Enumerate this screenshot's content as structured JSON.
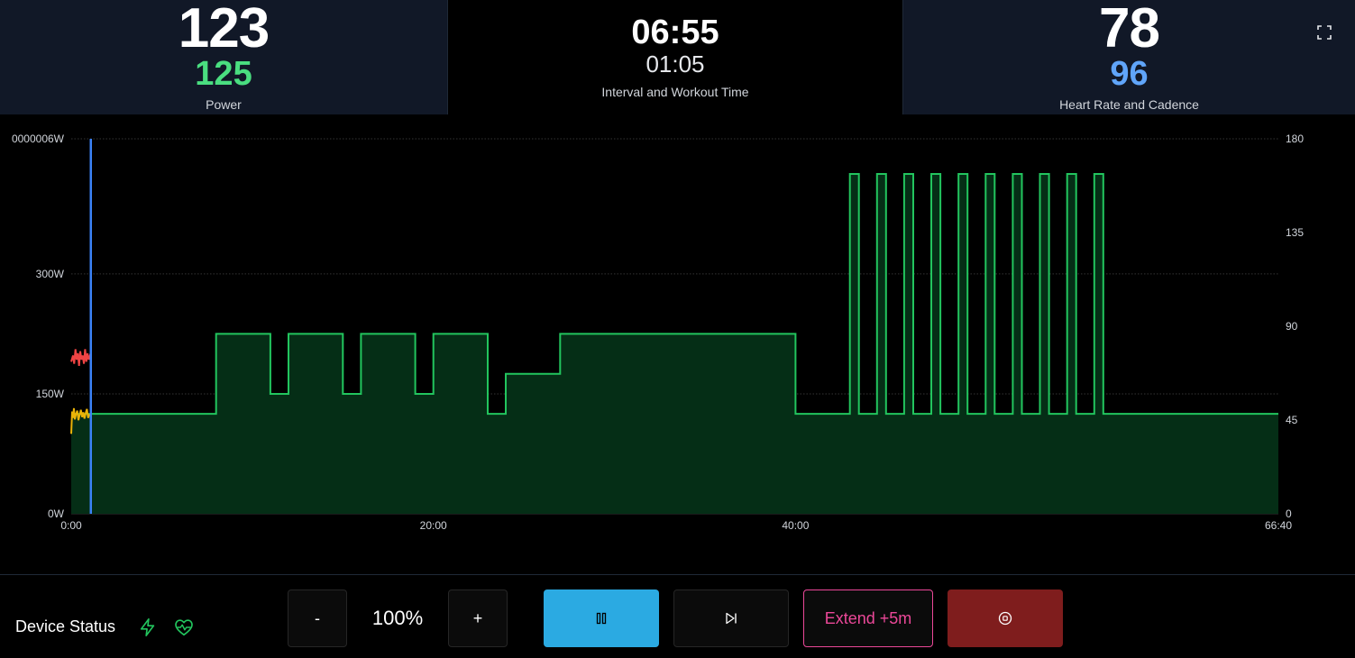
{
  "metrics": {
    "power": {
      "current": "123",
      "target": "125",
      "label": "Power"
    },
    "time": {
      "interval": "06:55",
      "workout": "01:05",
      "label": "Interval and Workout Time"
    },
    "heart": {
      "heart_rate": "78",
      "cadence": "96",
      "label": "Heart Rate and Cadence"
    }
  },
  "icons": {
    "fullscreen": "fullscreen-icon",
    "power_device": "lightning-icon",
    "heart_device": "heart-pulse-icon",
    "pause": "pause-icon",
    "skip": "skip-next-icon",
    "stop": "stop-circle-icon"
  },
  "colors": {
    "target": "#22c55e",
    "target_fill": "#052e16",
    "position": "#3b82f6",
    "heart_rate": "#ef4444",
    "power": "#eab308",
    "pause_button": "#2baae2",
    "extend": "#ec4899",
    "stop_button": "#7f1d1d"
  },
  "chart_data": {
    "type": "area",
    "x_unit": "seconds",
    "xlim": [
      0,
      4000
    ],
    "ylim": [
      0,
      469.0000006
    ],
    "y2lim": [
      0,
      180
    ],
    "x_ticks": [
      0,
      1200,
      2400,
      4000
    ],
    "x_tick_labels": [
      "0:00",
      "20:00",
      "40:00",
      "66:40"
    ],
    "y_tick_labels": [
      "0W",
      "150W",
      "300W",
      "0000006W"
    ],
    "y_ticks": [
      0,
      150,
      300,
      469
    ],
    "y2_tick_labels": [
      "0",
      "45",
      "90",
      "135",
      "180"
    ],
    "grid": true,
    "series": [
      {
        "id": "target-power",
        "points": [
          [
            0,
            125
          ],
          [
            480,
            125
          ],
          [
            480,
            225
          ],
          [
            660,
            225
          ],
          [
            660,
            150
          ],
          [
            720,
            150
          ],
          [
            720,
            225
          ],
          [
            900,
            225
          ],
          [
            900,
            150
          ],
          [
            960,
            150
          ],
          [
            960,
            225
          ],
          [
            1140,
            225
          ],
          [
            1140,
            150
          ],
          [
            1200,
            150
          ],
          [
            1200,
            225
          ],
          [
            1380,
            225
          ],
          [
            1380,
            125
          ],
          [
            1440,
            125
          ],
          [
            1440,
            175
          ],
          [
            1620,
            175
          ],
          [
            1620,
            225
          ],
          [
            2400,
            225
          ],
          [
            2400,
            125
          ],
          [
            2580,
            125
          ],
          [
            2580,
            425
          ],
          [
            2610,
            425
          ],
          [
            2610,
            125
          ],
          [
            2670,
            125
          ],
          [
            2670,
            425
          ],
          [
            2700,
            425
          ],
          [
            2700,
            125
          ],
          [
            2760,
            125
          ],
          [
            2760,
            425
          ],
          [
            2790,
            425
          ],
          [
            2790,
            125
          ],
          [
            2850,
            125
          ],
          [
            2850,
            425
          ],
          [
            2880,
            425
          ],
          [
            2880,
            125
          ],
          [
            2940,
            125
          ],
          [
            2940,
            425
          ],
          [
            2970,
            425
          ],
          [
            2970,
            125
          ],
          [
            3030,
            125
          ],
          [
            3030,
            425
          ],
          [
            3060,
            425
          ],
          [
            3060,
            125
          ],
          [
            3120,
            125
          ],
          [
            3120,
            425
          ],
          [
            3150,
            425
          ],
          [
            3150,
            125
          ],
          [
            3210,
            125
          ],
          [
            3210,
            425
          ],
          [
            3240,
            425
          ],
          [
            3240,
            125
          ],
          [
            3300,
            125
          ],
          [
            3300,
            425
          ],
          [
            3330,
            425
          ],
          [
            3330,
            125
          ],
          [
            3390,
            125
          ],
          [
            3390,
            425
          ],
          [
            3420,
            425
          ],
          [
            3420,
            125
          ],
          [
            4000,
            125
          ]
        ]
      },
      {
        "id": "heart-rate",
        "axis": "right",
        "points": [
          [
            0,
            73
          ],
          [
            6,
            76
          ],
          [
            10,
            72
          ],
          [
            14,
            79
          ],
          [
            18,
            74
          ],
          [
            22,
            77
          ],
          [
            26,
            71
          ],
          [
            30,
            78
          ],
          [
            34,
            74
          ],
          [
            38,
            76
          ],
          [
            42,
            72
          ],
          [
            46,
            79
          ],
          [
            50,
            73
          ],
          [
            54,
            77
          ],
          [
            58,
            74
          ],
          [
            62,
            76
          ],
          [
            65,
            75
          ]
        ]
      },
      {
        "id": "power",
        "points": [
          [
            0,
            100
          ],
          [
            3,
            128
          ],
          [
            6,
            120
          ],
          [
            9,
            132
          ],
          [
            12,
            118
          ],
          [
            16,
            125
          ],
          [
            20,
            129
          ],
          [
            24,
            117
          ],
          [
            28,
            124
          ],
          [
            32,
            130
          ],
          [
            36,
            121
          ],
          [
            40,
            127
          ],
          [
            44,
            119
          ],
          [
            48,
            126
          ],
          [
            52,
            131
          ],
          [
            56,
            120
          ],
          [
            60,
            124
          ],
          [
            65,
            123
          ]
        ]
      }
    ],
    "current_position": 65
  },
  "controls": {
    "device_status": "Device Status",
    "decrease": "-",
    "intensity": "100%",
    "increase": "+",
    "extend": "Extend +5m"
  }
}
